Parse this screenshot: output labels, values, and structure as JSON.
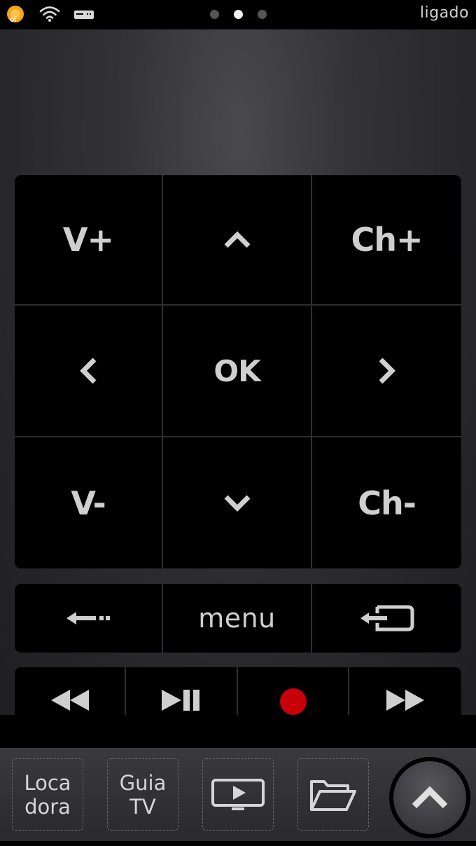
{
  "status_bar": {
    "carrier_logo_text": "oi",
    "connection_status": "ligado",
    "page_indicator": {
      "count": 3,
      "active_index": 1
    },
    "icons": [
      "oi-logo-icon",
      "wifi-icon",
      "tv-box-icon"
    ]
  },
  "dpad": {
    "volume_up": "V+",
    "channel_up": "Ch+",
    "ok": "OK",
    "volume_down": "V-",
    "channel_down": "Ch-",
    "icons": [
      "up-arrow-icon",
      "left-arrow-icon",
      "right-arrow-icon",
      "down-arrow-icon"
    ]
  },
  "nav_row": {
    "menu": "menu",
    "icons": [
      "back-arrow-icon",
      "exit-icon"
    ]
  },
  "media_row": {
    "icons": [
      "rewind-icon",
      "play-pause-icon",
      "record-icon",
      "fast-forward-icon"
    ],
    "record_color": "#c8000a"
  },
  "dock": {
    "locadora_line1": "Loca",
    "locadora_line2": "dora",
    "guia_line1": "Guia",
    "guia_line2": "TV",
    "icons": [
      "tv-play-icon",
      "folder-icon",
      "chevron-up-icon"
    ]
  }
}
